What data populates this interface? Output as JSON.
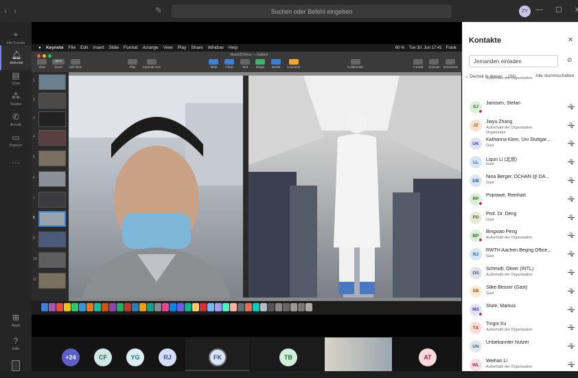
{
  "titlebar": {
    "search_placeholder": "Suchen oder Befehl eingeben",
    "user_initials": "ZY",
    "back": "‹",
    "forward": "›",
    "minimize": "—",
    "maximize": "☐",
    "close": "✕"
  },
  "rail": {
    "items": [
      {
        "label": "Info-Center",
        "icon": "location-icon"
      },
      {
        "label": "Aktivität",
        "icon": "bell-icon"
      },
      {
        "label": "Chat",
        "icon": "chat-icon"
      },
      {
        "label": "Teams",
        "icon": "teams-icon"
      },
      {
        "label": "Anrufe",
        "icon": "phone-icon"
      },
      {
        "label": "Dateien",
        "icon": "file-icon"
      },
      {
        "label": "···",
        "icon": "more-icon"
      }
    ],
    "bottom": [
      {
        "label": "Apps",
        "icon": "apps-icon"
      },
      {
        "label": "Hilfe",
        "icon": "help-icon"
      }
    ]
  },
  "mac": {
    "menu": [
      "Keynote",
      "File",
      "Edit",
      "Insert",
      "Slide",
      "Format",
      "Arrange",
      "View",
      "Play",
      "Share",
      "Window",
      "Help"
    ],
    "right": [
      "60 %",
      "Tue 30. Jun 17:41",
      "Frank"
    ],
    "doc_title": "Back2China — Edited",
    "toolbar": [
      "View",
      "Zoom",
      "Add Slide",
      "Play",
      "Keynote Live",
      "Table",
      "Chart",
      "Text",
      "Shape",
      "Media",
      "Comment",
      "Collaborate",
      "Format",
      "Animate",
      "Document"
    ],
    "zoom_value": "68 %",
    "slide_numbers": [
      "1",
      "2",
      "3",
      "4",
      "5",
      "6",
      "7",
      "8",
      "9",
      "10",
      "11"
    ]
  },
  "participants": [
    {
      "initials": "+24",
      "color": "#5b5fc7",
      "text": "#ffffff"
    },
    {
      "initials": "CF",
      "color": "#cfe8e6",
      "text": "#1d6b66"
    },
    {
      "initials": "YG",
      "color": "#d9eef0",
      "text": "#1f6d78"
    },
    {
      "initials": "RJ",
      "color": "#d4dff5",
      "text": "#2f4f9a"
    },
    {
      "initials": "FK",
      "color": "#d9e4f5",
      "text": "#2f4f9a"
    },
    {
      "initials": "TB",
      "color": "#d3efd9",
      "text": "#21703a"
    },
    {
      "initials": "AT",
      "color": "#fbd9de",
      "text": "#a2283f"
    }
  ],
  "contacts": {
    "title": "Kontakte",
    "invite_placeholder": "Jemanden einladen",
    "section": "Derzeit in dieser ... (32)",
    "mute_all": "Alle stummschalten",
    "people": [
      {
        "initials": "",
        "name": "",
        "sub": [
          "Außerhalb der Organisation"
        ],
        "color": "#e8e8e8",
        "text": "#666",
        "dot": false
      },
      {
        "initials": "SJ",
        "name": "Janssen, Stefan",
        "sub": [],
        "color": "#dcefd8",
        "text": "#2c6b2a",
        "dot": true
      },
      {
        "initials": "JZ",
        "name": "Jiayu Zhang",
        "sub": [
          "Außerhalb der Organisation",
          "Organisator"
        ],
        "color": "#fbe3d2",
        "text": "#9a4a1a",
        "dot": false
      },
      {
        "initials": "UK",
        "name": "Katharina Klein, Uni Stuttgar...",
        "sub": [
          "Gast"
        ],
        "color": "#e0e3f5",
        "text": "#3a3f8f",
        "dot": false
      },
      {
        "initials": "LL",
        "name": "Liqun Li (北京)",
        "sub": [
          "Gast"
        ],
        "color": "#d8e6f5",
        "text": "#2a5792",
        "dot": false
      },
      {
        "initials": "DB",
        "name": "Nina Berger, DCHAN @ DA...",
        "sub": [
          "Gast"
        ],
        "color": "#d8e6f5",
        "text": "#2a5792",
        "dot": false
      },
      {
        "initials": "RP",
        "name": "Poprawe, Reinhart",
        "sub": [],
        "color": "#dcefd8",
        "text": "#2c6b2a",
        "dot": true
      },
      {
        "initials": "PD",
        "name": "Prof. Dr. Deng",
        "sub": [
          "Gast"
        ],
        "color": "#e6ecd8",
        "text": "#4e6b22",
        "dot": false
      },
      {
        "initials": "BP",
        "name": "Bingxiao Peng",
        "sub": [
          "Außerhalb der Organisation"
        ],
        "color": "#dcefd8",
        "text": "#2c6b2a",
        "dot": true
      },
      {
        "initials": "RJ",
        "name": "RWTH Aachen Beijing Office...",
        "sub": [
          "Gast"
        ],
        "color": "#d8e6f5",
        "text": "#2a5792",
        "dot": false
      },
      {
        "initials": "OS",
        "name": "Schmidt, Oliver (INTL)",
        "sub": [
          "Außerhalb der Organisation"
        ],
        "color": "#e3e3ec",
        "text": "#464a6b",
        "dot": false
      },
      {
        "initials": "SB",
        "name": "Silke Besser (Gast)",
        "sub": [
          "Gast"
        ],
        "color": "#fbebd2",
        "text": "#8a5a16",
        "dot": false
      },
      {
        "initials": "MS",
        "name": "Stute, Markus",
        "sub": [],
        "color": "#e0e3f5",
        "text": "#3a3f8f",
        "dot": true
      },
      {
        "initials": "TX",
        "name": "Tingni Xu",
        "sub": [
          "Außerhalb der Organisation"
        ],
        "color": "#fbdcd6",
        "text": "#9a3322",
        "dot": false
      },
      {
        "initials": "UN",
        "name": "Unbekannter Nutzer",
        "sub": [],
        "color": "#e3e8ec",
        "text": "#44545f",
        "dot": false
      },
      {
        "initials": "WL",
        "name": "Weihan Li",
        "sub": [
          "Außerhalb der Organisation"
        ],
        "color": "#f8dde7",
        "text": "#92294f",
        "dot": false
      }
    ]
  }
}
